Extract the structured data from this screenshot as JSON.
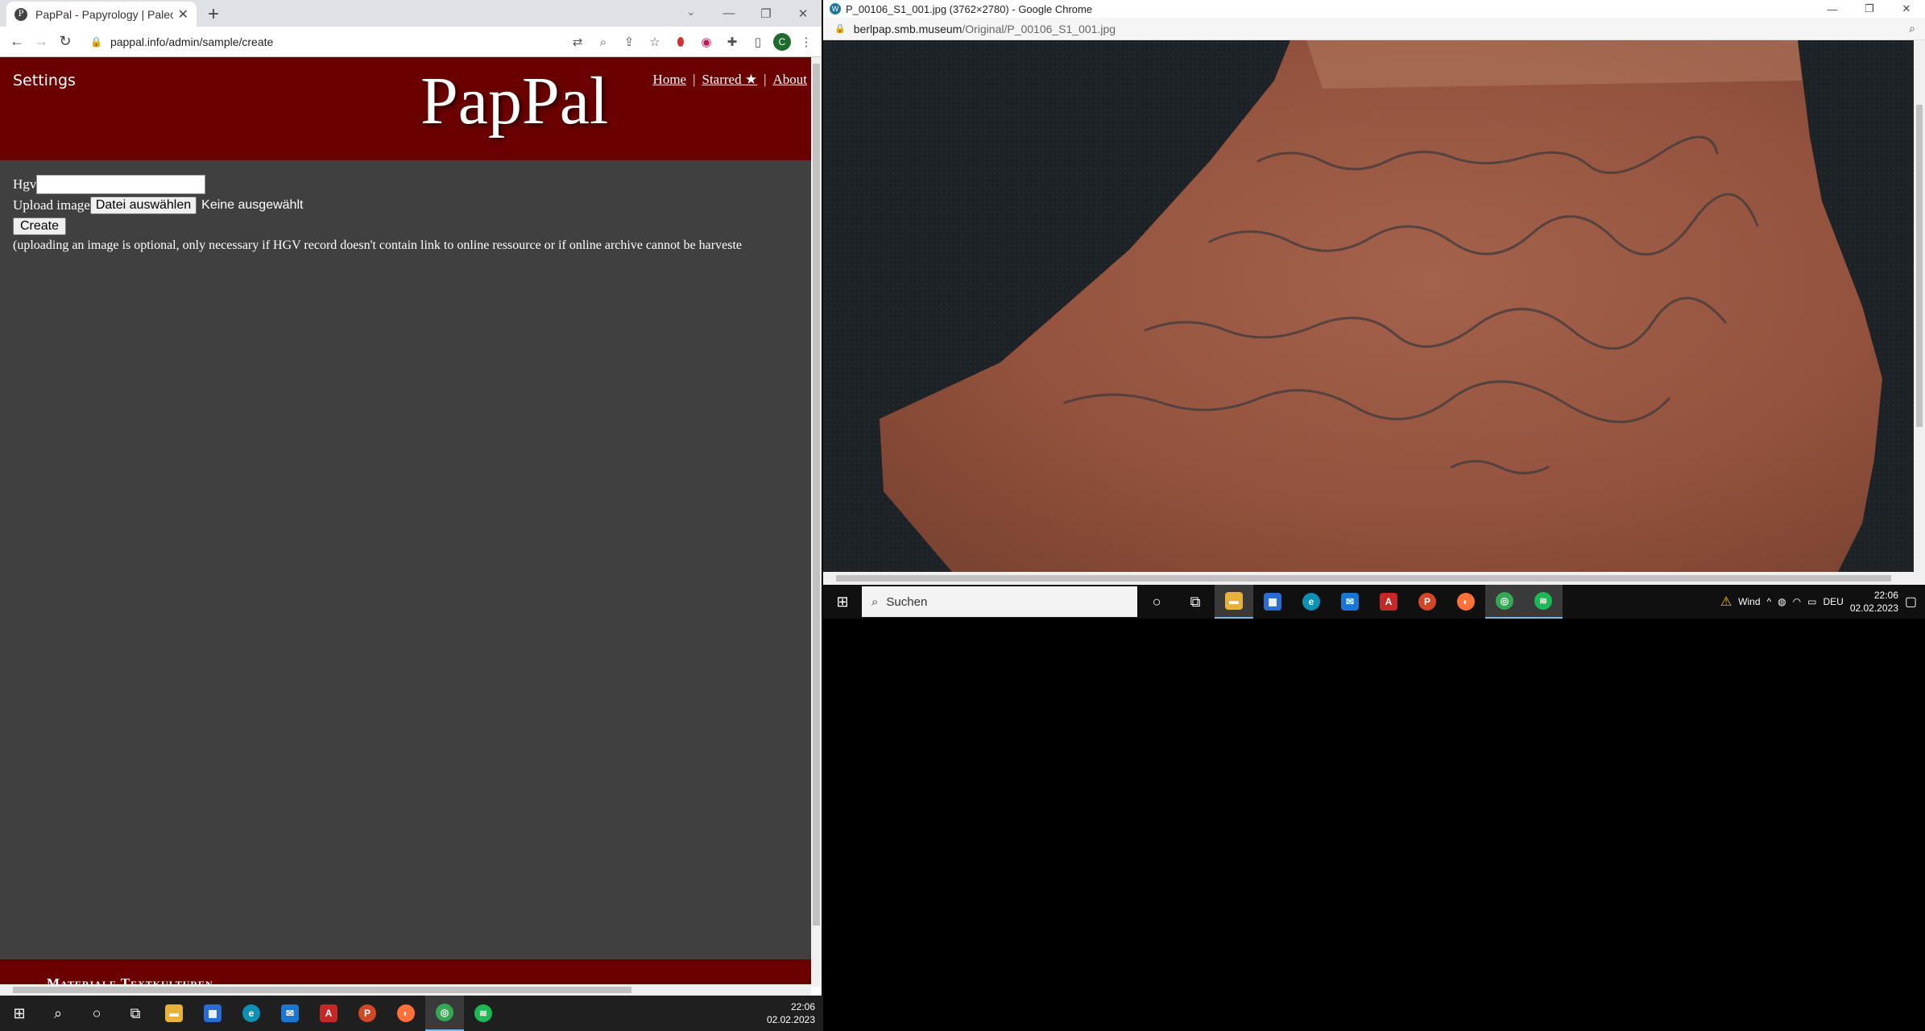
{
  "left_browser": {
    "tab_title": "PapPal - Papyrology | Paleograph",
    "tab_favicon": "P",
    "url": "pappal.info/admin/sample/create",
    "profile_initial": "C"
  },
  "site": {
    "settings_label": "Settings",
    "brand": "PapPal",
    "nav": {
      "home": "Home",
      "sep1": "|",
      "starred": "Starred ★",
      "sep2": "|",
      "about": "About"
    },
    "form": {
      "hgv_label": "Hgv",
      "hgv_value": "",
      "upload_label": "Upload image",
      "file_button": "Datei auswählen",
      "file_status": "Keine ausgewählt",
      "create_button": "Create",
      "note": "(uploading an image is optional, only necessary if HGV record doesn't contain link to online ressource or if online archive cannot be harveste"
    },
    "footer_text": "Materiale Textkulturen"
  },
  "right_browser": {
    "window_title": "P_00106_S1_001.jpg (3762×2780) - Google Chrome",
    "url_host": "berlpap.smb.museum",
    "url_path": "/Original/P_00106_S1_001.jpg"
  },
  "taskbar_right": {
    "search_placeholder": "Suchen",
    "weather": "Wind",
    "language": "DEU",
    "time": "22:06",
    "date": "02.02.2023"
  },
  "taskbar_main": {
    "time": "22:06",
    "date": "02.02.2023"
  },
  "colors": {
    "header_red": "#6b0000",
    "page_bg": "#404040",
    "sherd": "#9c5a44"
  }
}
